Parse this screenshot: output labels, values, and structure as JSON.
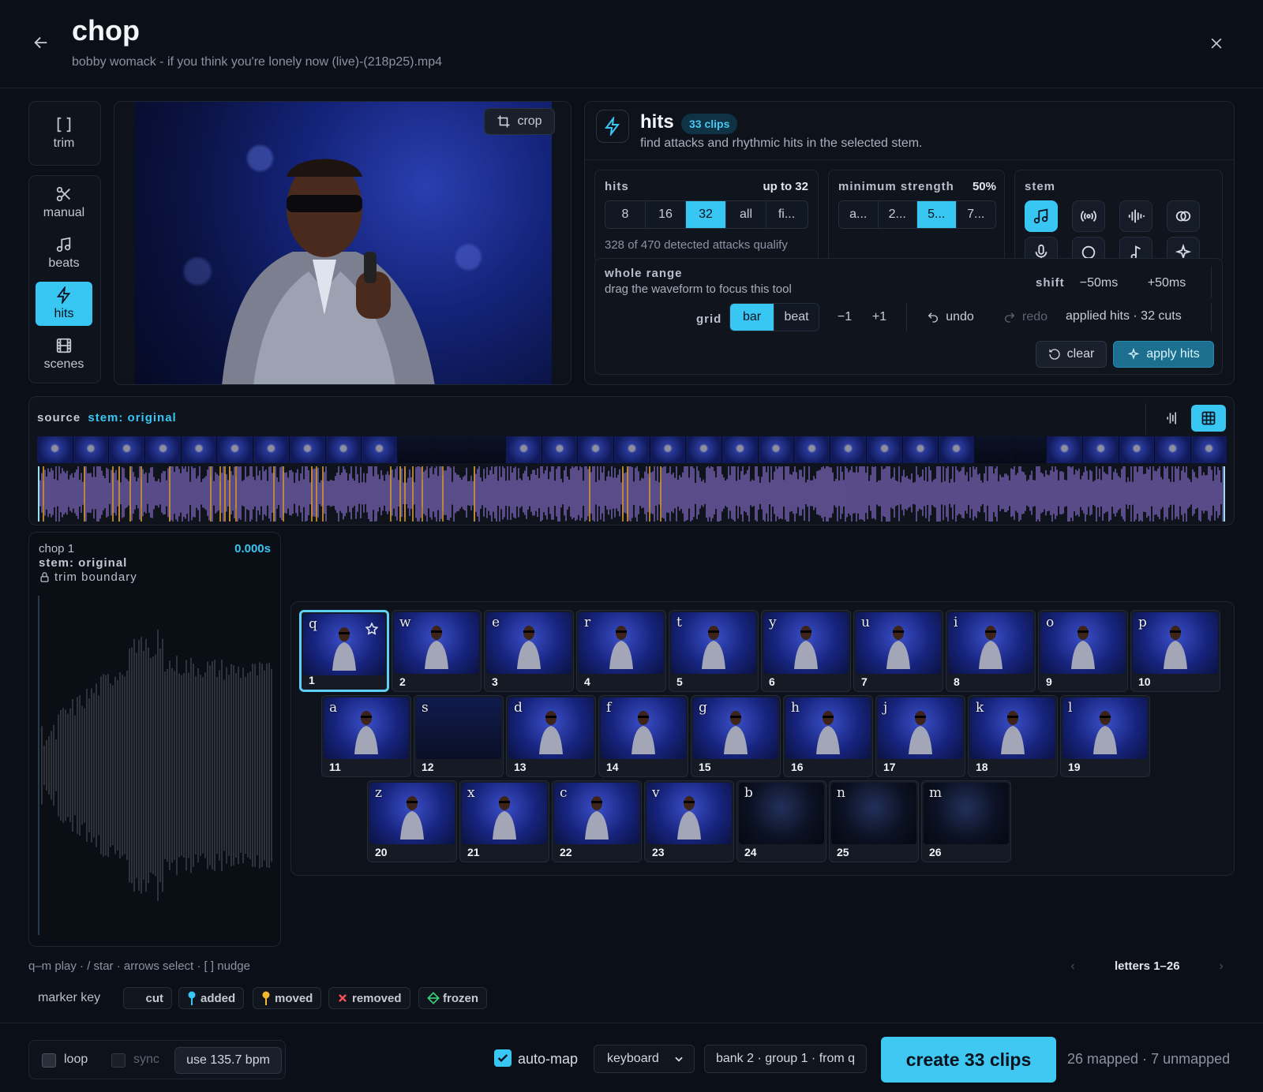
{
  "header": {
    "title": "chop",
    "subtitle": "bobby womack - if you think you're lonely now (live)-(218p25).mp4"
  },
  "nav": {
    "trim": "trim",
    "manual": "manual",
    "beats": "beats",
    "hits": "hits",
    "scenes": "scenes"
  },
  "preview": {
    "crop_label": "crop"
  },
  "hits_panel": {
    "title": "hits",
    "badge": "33 clips",
    "description": "find attacks and rhythmic hits in the selected stem.",
    "hits_label": "hits",
    "hits_max": "up to 32",
    "hits_options": [
      "8",
      "16",
      "32",
      "all",
      "fi..."
    ],
    "hits_selected": "32",
    "qualify_text": "328 of 470 detected attacks qualify",
    "strength_label": "minimum strength",
    "strength_value": "50%",
    "strength_options": [
      "a...",
      "2...",
      "5...",
      "7..."
    ],
    "strength_selected": "5...",
    "stem_label": "stem",
    "stem_icons": [
      "music-note-icon",
      "radio-waves-icon",
      "waveform-icon",
      "link-icon",
      "microphone-icon",
      "circle-icon",
      "eighth-note-icon",
      "sparkle-icon"
    ],
    "range_title": "whole range",
    "range_desc": "drag the waveform to focus this tool",
    "shift_label": "shift",
    "shift_minus": "−50ms",
    "shift_plus": "+50ms",
    "grid_label": "grid",
    "grid_options": [
      "bar",
      "beat"
    ],
    "grid_selected": "bar",
    "minus_one": "−1",
    "plus_one": "+1",
    "undo": "undo",
    "redo": "redo",
    "applied_text": "applied hits · 32 cuts",
    "clear": "clear",
    "apply": "apply hits"
  },
  "source": {
    "label": "source",
    "stem": "stem: original"
  },
  "chop": {
    "name": "chop 1",
    "stem": "stem: original",
    "trim": "trim boundary",
    "time": "0.000s"
  },
  "keys": {
    "row1": [
      {
        "l": "q",
        "n": "1"
      },
      {
        "l": "w",
        "n": "2"
      },
      {
        "l": "e",
        "n": "3"
      },
      {
        "l": "r",
        "n": "4"
      },
      {
        "l": "t",
        "n": "5"
      },
      {
        "l": "y",
        "n": "6"
      },
      {
        "l": "u",
        "n": "7"
      },
      {
        "l": "i",
        "n": "8"
      },
      {
        "l": "o",
        "n": "9"
      },
      {
        "l": "p",
        "n": "10"
      }
    ],
    "row2": [
      {
        "l": "a",
        "n": "11"
      },
      {
        "l": "s",
        "n": "12"
      },
      {
        "l": "d",
        "n": "13"
      },
      {
        "l": "f",
        "n": "14"
      },
      {
        "l": "g",
        "n": "15"
      },
      {
        "l": "h",
        "n": "16"
      },
      {
        "l": "j",
        "n": "17"
      },
      {
        "l": "k",
        "n": "18"
      },
      {
        "l": "l",
        "n": "19"
      }
    ],
    "row3": [
      {
        "l": "z",
        "n": "20"
      },
      {
        "l": "x",
        "n": "21"
      },
      {
        "l": "c",
        "n": "22"
      },
      {
        "l": "v",
        "n": "23"
      },
      {
        "l": "b",
        "n": "24"
      },
      {
        "l": "n",
        "n": "25"
      },
      {
        "l": "m",
        "n": "26"
      }
    ]
  },
  "help_text": "q–m play · / star · arrows select · [ ] nudge",
  "pager": {
    "label": "letters 1–26"
  },
  "marker_key": {
    "label": "marker key",
    "cut": "cut",
    "added": "added",
    "moved": "moved",
    "removed": "removed",
    "frozen": "frozen"
  },
  "footer": {
    "loop": "loop",
    "sync": "sync",
    "bpm": "use 135.7 bpm",
    "automap": "auto-map",
    "mode": "keyboard",
    "bank": "bank 2 · group 1 · from q",
    "create": "create 33 clips",
    "mapped": "26 mapped · 7 unmapped"
  },
  "colors": {
    "accent": "#38c6f2",
    "waveform": "#7a64b8",
    "marker": "#e4a533",
    "background": "#0b0f17"
  }
}
